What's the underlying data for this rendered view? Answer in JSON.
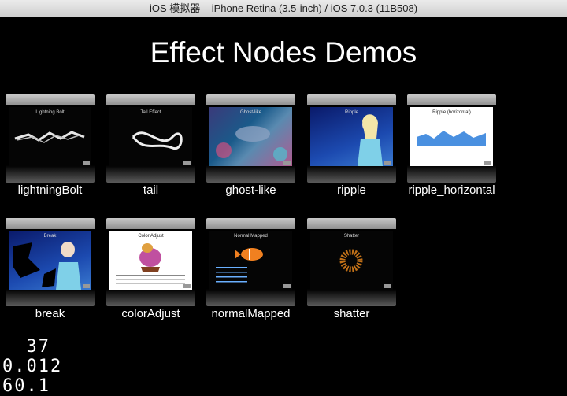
{
  "window": {
    "title": "iOS 模拟器 – iPhone Retina (3.5-inch) / iOS 7.0.3 (11B508)"
  },
  "page": {
    "title": "Effect Nodes Demos"
  },
  "demos": [
    {
      "label": "lightningBolt",
      "screen_title": "Lightning Bolt"
    },
    {
      "label": "tail",
      "screen_title": "Tail Effect"
    },
    {
      "label": "ghost-like",
      "screen_title": "Ghost-like"
    },
    {
      "label": "ripple",
      "screen_title": "Ripple"
    },
    {
      "label": "ripple_horizontal",
      "screen_title": "Ripple (horizontal)"
    },
    {
      "label": "break",
      "screen_title": "Break"
    },
    {
      "label": "colorAdjust",
      "screen_title": "Color Adjust"
    },
    {
      "label": "normalMapped",
      "screen_title": "Normal Mapped"
    },
    {
      "label": "shatter",
      "screen_title": "Shatter"
    }
  ],
  "stats": {
    "line1": "  37",
    "line2": "0.012",
    "line3": "60.1"
  }
}
